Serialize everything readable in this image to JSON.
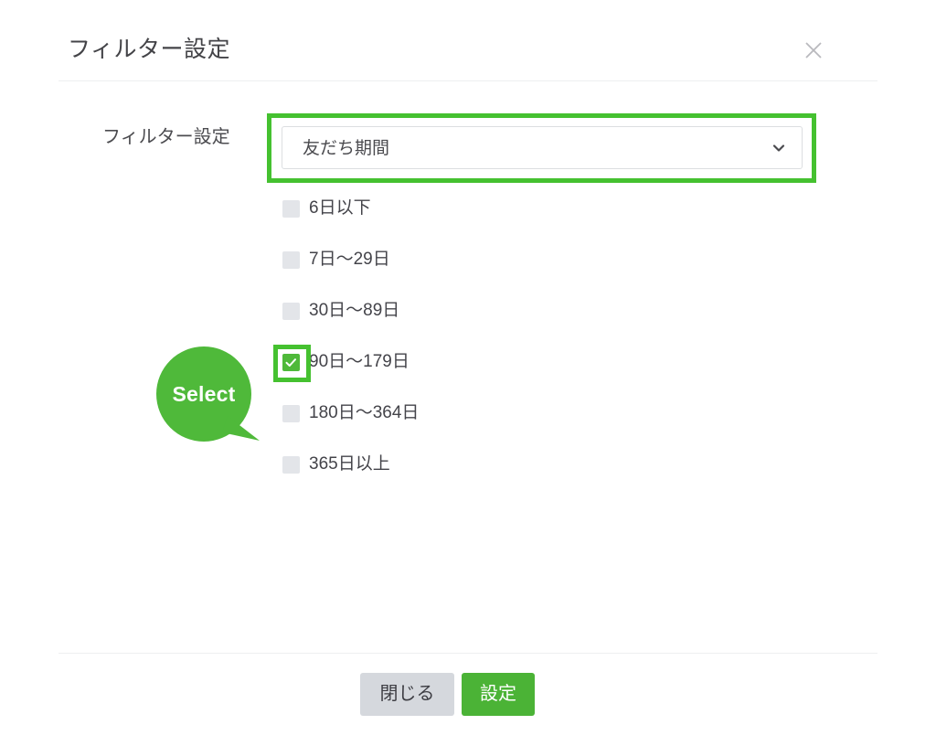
{
  "dialog": {
    "title": "フィルター設定",
    "close_icon": "close-icon"
  },
  "filter": {
    "label": "フィルター設定",
    "select": {
      "value": "友だち期間",
      "chevron_icon": "chevron-down-icon"
    },
    "options": [
      {
        "label": "6日以下",
        "checked": false
      },
      {
        "label": "7日〜29日",
        "checked": false
      },
      {
        "label": "30日〜89日",
        "checked": false
      },
      {
        "label": "90日〜179日",
        "checked": true
      },
      {
        "label": "180日〜364日",
        "checked": false
      },
      {
        "label": "365日以上",
        "checked": false
      }
    ]
  },
  "callout": {
    "text": "Select"
  },
  "footer": {
    "close_label": "閉じる",
    "submit_label": "設定"
  },
  "colors": {
    "accent_green": "#45c130",
    "button_green": "#4bb336",
    "checkbox_green": "#4fb93a",
    "button_gray": "#d5d8dd",
    "text_dark": "#44444a",
    "divider": "#eeeff1"
  }
}
